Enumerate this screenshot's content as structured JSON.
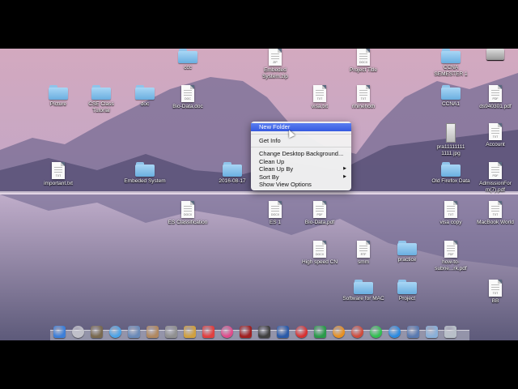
{
  "desktop": {
    "icons": [
      {
        "label": "ccc",
        "kind": "folder"
      },
      {
        "label": "Embeded System.zip",
        "kind": "doc",
        "ext": "ZIP"
      },
      {
        "label": "Project Title",
        "kind": "doc",
        "ext": "DOCX"
      },
      {
        "label": "CCNA SEMESTER 1",
        "kind": "folder"
      },
      {
        "label": "",
        "kind": "disk"
      },
      {
        "label": "Picture",
        "kind": "folder"
      },
      {
        "label": "CSE Class Tutorial",
        "kind": "folder"
      },
      {
        "label": "doc",
        "kind": "folder"
      },
      {
        "label": "Bio-Data.doc",
        "kind": "doc",
        "ext": "DOC"
      },
      {
        "label": "visa.txt",
        "kind": "doc",
        "ext": "TXT"
      },
      {
        "label": "rihinehoth",
        "kind": "doc",
        "ext": "TXT"
      },
      {
        "label": "CCNA1",
        "kind": "folder"
      },
      {
        "label": "ds940301.pdf",
        "kind": "doc",
        "ext": "PDF"
      },
      {
        "label": "pra11111111 1111.jpg",
        "kind": "image"
      },
      {
        "label": "Account",
        "kind": "doc",
        "ext": "TXT"
      },
      {
        "label": "important.txt",
        "kind": "doc",
        "ext": "TXT"
      },
      {
        "label": "Embeded System",
        "kind": "folder"
      },
      {
        "label": "2016-08-17",
        "kind": "folder"
      },
      {
        "label": "Old Firefox Data",
        "kind": "folder"
      },
      {
        "label": "AdmissionFor m(7).pdf",
        "kind": "doc",
        "ext": "PDF"
      },
      {
        "label": "ES Classification",
        "kind": "doc",
        "ext": "DOCX"
      },
      {
        "label": "ES 1",
        "kind": "doc",
        "ext": "DOCX"
      },
      {
        "label": "Bio-Data.pdf",
        "kind": "doc",
        "ext": "PDF"
      },
      {
        "label": "visa copy",
        "kind": "doc",
        "ext": "TXT"
      },
      {
        "label": "MacBook World",
        "kind": "doc",
        "ext": "TXT"
      },
      {
        "label": "High speed CN",
        "kind": "doc",
        "ext": "DOCX"
      },
      {
        "label": "smm",
        "kind": "doc",
        "ext": "RTF"
      },
      {
        "label": "practice",
        "kind": "folder"
      },
      {
        "label": "how-to-subne...rk.pdf",
        "kind": "doc",
        "ext": "PDF"
      },
      {
        "label": "Software for MAC",
        "kind": "folder"
      },
      {
        "label": "Project",
        "kind": "folder"
      },
      {
        "label": "BB",
        "kind": "doc",
        "ext": "TXT"
      }
    ]
  },
  "context_menu": {
    "items": [
      {
        "label": "New Folder",
        "highlighted": true
      },
      {
        "separator": true
      },
      {
        "label": "Get Info"
      },
      {
        "separator": true
      },
      {
        "label": "Change Desktop Background..."
      },
      {
        "label": "Clean Up"
      },
      {
        "label": "Clean Up By",
        "submenu": true
      },
      {
        "label": "Sort By",
        "submenu": true
      },
      {
        "label": "Show View Options"
      }
    ]
  },
  "dock": {
    "apps": [
      {
        "name": "finder-icon",
        "color": "#3d7fd8"
      },
      {
        "name": "launchpad-icon",
        "color": "#c0c0c8"
      },
      {
        "name": "photo-app-icon",
        "color": "#7a6a50"
      },
      {
        "name": "safari-icon",
        "color": "#4aa3e8"
      },
      {
        "name": "mail-icon",
        "color": "#6a8ab8"
      },
      {
        "name": "contacts-icon",
        "color": "#b08860"
      },
      {
        "name": "system-preferences-icon",
        "color": "#909090"
      },
      {
        "name": "preview-icon",
        "color": "#d0a040"
      },
      {
        "name": "calendar-icon",
        "color": "#e04040"
      },
      {
        "name": "itunes-icon",
        "color": "#e04a8a"
      },
      {
        "name": "app-store-icon",
        "color": "#a02020"
      },
      {
        "name": "terminal-icon",
        "color": "#404040"
      },
      {
        "name": "word-icon",
        "color": "#2a5aa8"
      },
      {
        "name": "opera-icon",
        "color": "#d83030"
      },
      {
        "name": "excel-icon",
        "color": "#2a9a4a"
      },
      {
        "name": "vlc-icon",
        "color": "#e89020"
      },
      {
        "name": "chrome-icon",
        "color": "#d04a3a"
      },
      {
        "name": "whatsapp-icon",
        "color": "#30c050"
      },
      {
        "name": "skype-icon",
        "color": "#2a8ae0"
      },
      {
        "name": "folder-stack-icon",
        "color": "#5a7ab0"
      },
      {
        "name": "downloads-icon",
        "color": "#8ab0d8"
      },
      {
        "name": "trash-icon",
        "color": "#b8c0c8"
      }
    ]
  }
}
